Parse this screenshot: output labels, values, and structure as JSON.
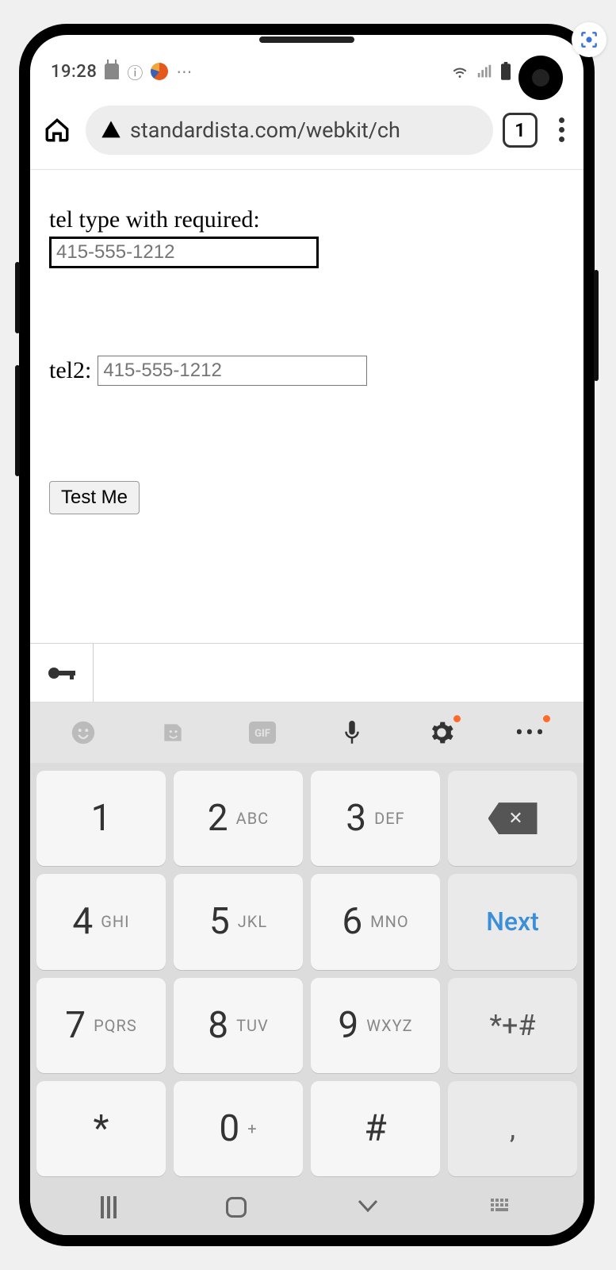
{
  "status": {
    "time": "19:28",
    "icons": {
      "info": "ⓘ",
      "dots": "⋯",
      "wifi": "wifi",
      "signal": "signal",
      "battery": "battery"
    }
  },
  "browser": {
    "url": "standardista.com/webkit/ch",
    "tab_count": "1"
  },
  "form": {
    "tel1_label": "tel type with required:",
    "tel1_placeholder": "415-555-1212",
    "tel2_label": "tel2:",
    "tel2_placeholder": "415-555-1212",
    "button_label": "Test Me"
  },
  "keyboard": {
    "toolbar": [
      "emoji",
      "sticker",
      "gif",
      "mic",
      "settings",
      "more"
    ],
    "keys": [
      {
        "d": "1",
        "l": ""
      },
      {
        "d": "2",
        "l": "ABC"
      },
      {
        "d": "3",
        "l": "DEF"
      },
      {
        "action": "backspace"
      },
      {
        "d": "4",
        "l": "GHI"
      },
      {
        "d": "5",
        "l": "JKL"
      },
      {
        "d": "6",
        "l": "MNO"
      },
      {
        "action": "next",
        "label": "Next"
      },
      {
        "d": "7",
        "l": "PQRS"
      },
      {
        "d": "8",
        "l": "TUV"
      },
      {
        "d": "9",
        "l": "WXYZ"
      },
      {
        "action": "sym",
        "label": "*+#"
      },
      {
        "d": "*",
        "l": ""
      },
      {
        "d": "0",
        "l": "+"
      },
      {
        "d": "#",
        "l": ""
      },
      {
        "action": "comma",
        "label": ","
      }
    ]
  }
}
